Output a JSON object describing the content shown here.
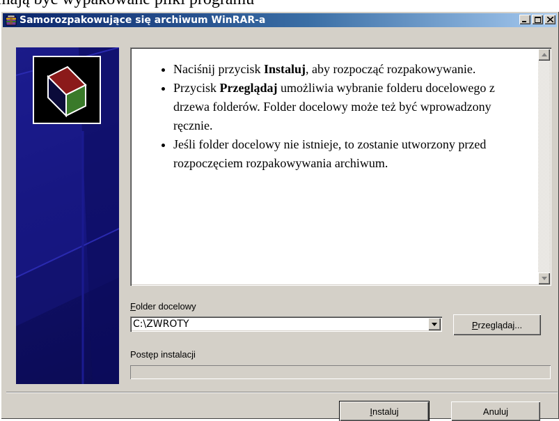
{
  "background_caption": "mają być wypakowane pliki programu",
  "window": {
    "title": "Samorozpakowujące się archiwum WinRAR-a",
    "title_icon": "winrar-archive-icon",
    "controls": {
      "minimize": "minimize-icon",
      "maximize": "maximize-icon",
      "close": "close-icon"
    }
  },
  "info": {
    "items": [
      {
        "pre": "Naciśnij przycisk ",
        "bold": "Instaluj",
        "post": ", aby rozpocząć rozpakowywanie."
      },
      {
        "pre": "Przycisk ",
        "bold": "Przeglądaj",
        "post": " umożliwia wybranie folderu docelowego z drzewa folderów. Folder docelowy może też być wprowadzony ręcznie."
      },
      {
        "pre": "Jeśli folder docelowy nie istnieje, to zostanie utworzony przed rozpoczęciem rozpakowywania archiwum.",
        "bold": "",
        "post": ""
      }
    ]
  },
  "folder": {
    "label_accel": "F",
    "label_rest": "older docelowy",
    "value": "C:\\ZWROTY",
    "browse_accel": "P",
    "browse_rest": "rzeglądaj..."
  },
  "progress": {
    "label": "Postęp instalacji",
    "fraction": 0
  },
  "buttons": {
    "install_accel": "I",
    "install_rest": "nstaluj",
    "cancel": "Anuluj"
  },
  "colors": {
    "face": "#d4d0c8",
    "title_start": "#0a246a",
    "title_end": "#a6caf0",
    "side_panel": "#10106a"
  }
}
